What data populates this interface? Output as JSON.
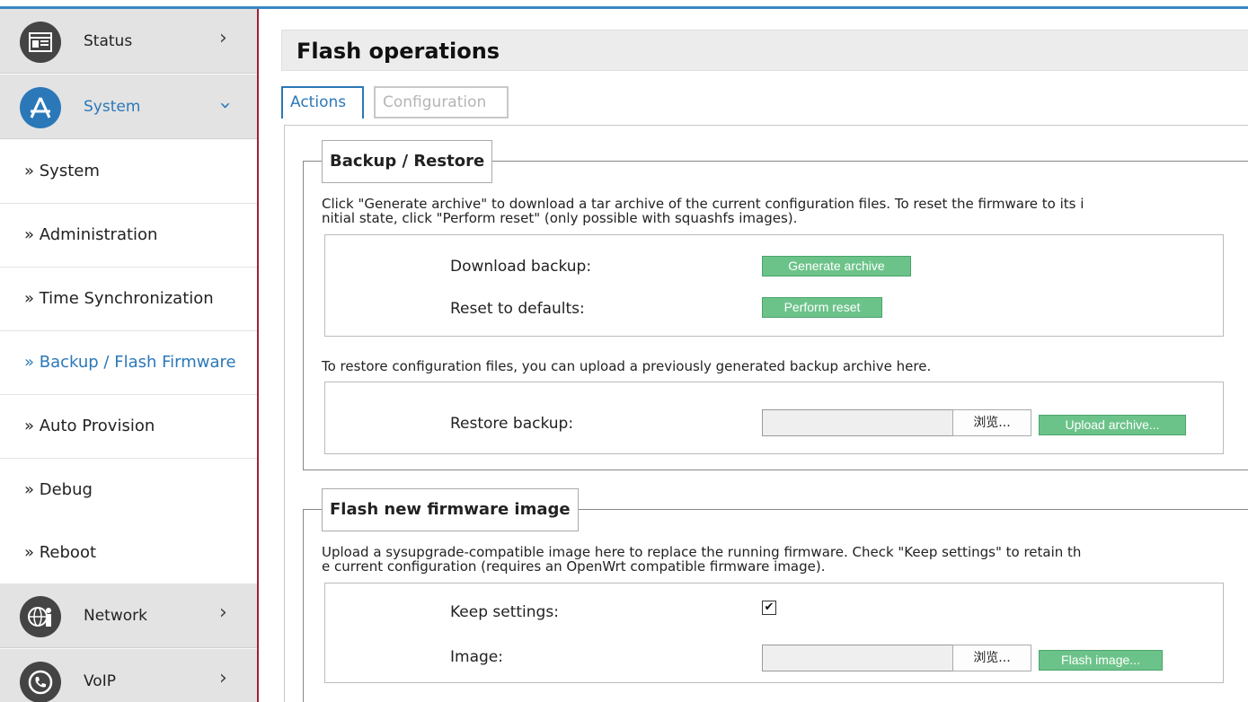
{
  "sidebar": {
    "categories": [
      {
        "label": "Status",
        "icon": "status-icon"
      },
      {
        "label": "System",
        "icon": "app-store-icon"
      },
      {
        "label": "Network",
        "icon": "globe-person-icon"
      },
      {
        "label": "VoIP",
        "icon": "phone-icon"
      }
    ],
    "items": [
      {
        "label": "» System"
      },
      {
        "label": "» Administration"
      },
      {
        "label": "» Time Synchronization"
      },
      {
        "label": "» Backup / Flash Firmware"
      },
      {
        "label": "» Auto Provision"
      },
      {
        "label": "» Debug"
      },
      {
        "label": "» Reboot"
      }
    ],
    "active_item": "» Backup / Flash Firmware"
  },
  "page": {
    "title": "Flash operations",
    "tabs": [
      {
        "label": "Actions",
        "active": true
      },
      {
        "label": "Configuration",
        "active": false
      }
    ]
  },
  "backup": {
    "legend": "Backup / Restore",
    "desc_line1": "Click \"Generate archive\" to download a tar archive of the current configuration files. To reset the firmware to its i",
    "desc_line2": "nitial state, click \"Perform reset\" (only possible with squashfs images).",
    "download_label": "Download backup:",
    "generate_btn": "Generate archive",
    "reset_label": "Reset to defaults:",
    "reset_btn": "Perform reset",
    "restore_desc": "To restore configuration files, you can upload a previously generated backup archive here.",
    "restore_label": "Restore backup:",
    "browse_btn": "浏览...",
    "upload_btn": "Upload archive..."
  },
  "flash": {
    "legend": "Flash new firmware image",
    "desc_line1": "Upload a sysupgrade-compatible image here to replace the running firmware. Check \"Keep settings\" to retain th",
    "desc_line2": "e current configuration (requires an OpenWrt compatible firmware image).",
    "keep_label": "Keep settings:",
    "keep_checked": true,
    "check_mark": "✔",
    "image_label": "Image:",
    "browse_btn": "浏览...",
    "flash_btn": "Flash image..."
  },
  "colors": {
    "accent": "#2b78b8",
    "button_green": "#6cc38a",
    "sidebar_border": "#9b2335"
  }
}
